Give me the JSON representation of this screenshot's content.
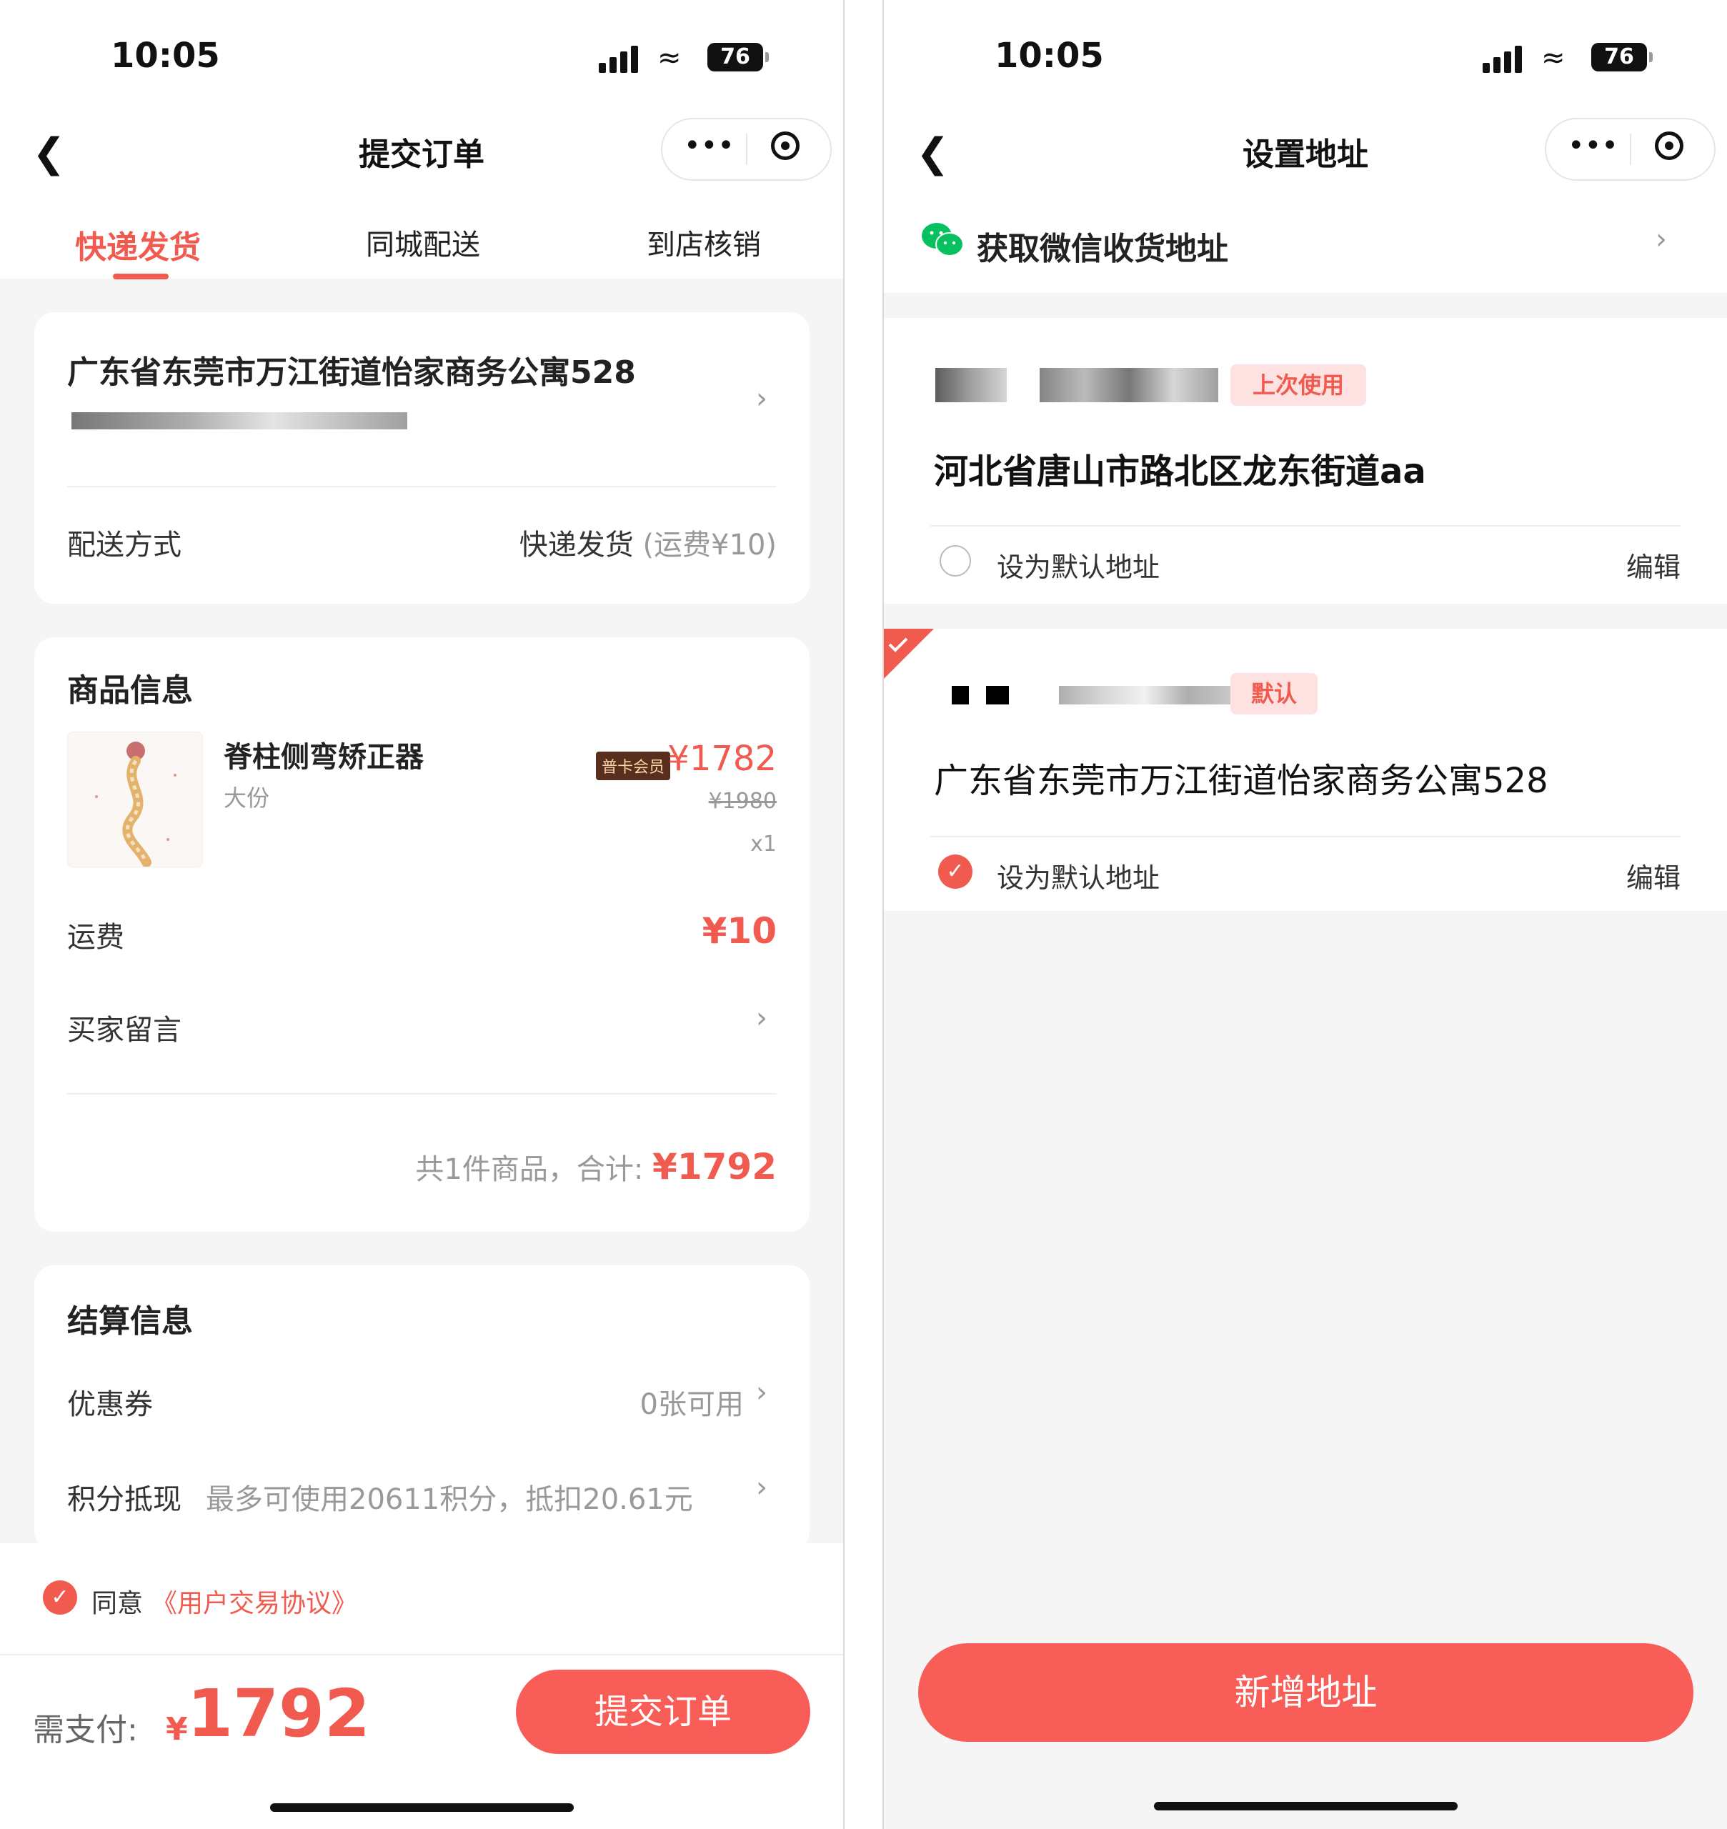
{
  "left": {
    "status": {
      "time": "10:05",
      "battery": "76"
    },
    "nav": {
      "title": "提交订单"
    },
    "tabs": [
      "快递发货",
      "同城配送",
      "到店核销"
    ],
    "address": {
      "line": "广东省东莞市万江街道怡家商务公寓528"
    },
    "delivery": {
      "label": "配送方式",
      "value": "快递发货",
      "fee": "(运费¥10)"
    },
    "product_section": {
      "title": "商品信息",
      "name": "脊柱侧弯矫正器",
      "spec": "大份",
      "badge": "普卡会员",
      "price": "¥1782",
      "original_price": "¥1980",
      "qty": "x1",
      "shipping_label": "运费",
      "shipping_value": "¥10",
      "note_label": "买家留言",
      "summary_prefix": "共1件商品，合计:",
      "summary_total": "¥1792"
    },
    "settle": {
      "title": "结算信息",
      "coupon_label": "优惠券",
      "coupon_value": "0张可用",
      "points_label": "积分抵现",
      "points_value": "最多可使用20611积分，抵扣20.61元"
    },
    "agree": {
      "text": "同意",
      "link": "《用户交易协议》"
    },
    "footer": {
      "pay_label": "需支付:",
      "currency": "¥",
      "amount": "1792",
      "submit": "提交订单"
    }
  },
  "right": {
    "status": {
      "time": "10:05",
      "battery": "76"
    },
    "nav": {
      "title": "设置地址"
    },
    "wechat": {
      "label": "获取微信收货地址"
    },
    "addresses": [
      {
        "tag": "上次使用",
        "line": "河北省唐山市路北区龙东街道aa",
        "default_label": "设为默认地址",
        "edit": "编辑",
        "selected": false
      },
      {
        "tag": "默认",
        "line": "广东省东莞市万江街道怡家商务公寓528",
        "default_label": "设为默认地址",
        "edit": "编辑",
        "selected": true
      }
    ],
    "add_button": "新增地址"
  },
  "colors": {
    "accent": "#f05a4f",
    "button": "#f95d57",
    "tag_bg": "#fde2e1",
    "wechat": "#07c160"
  },
  "icons": [
    "back-icon",
    "more-icon",
    "close-target-icon",
    "chevron-right-icon",
    "check-icon",
    "wechat-icon",
    "signal-icon",
    "wifi-icon",
    "battery-icon"
  ]
}
